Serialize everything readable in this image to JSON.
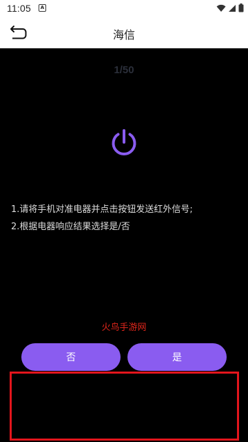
{
  "status_bar": {
    "time": "11:05",
    "notification_glyph": "A",
    "icons": [
      "wifi-icon",
      "signal-icon",
      "battery-icon"
    ]
  },
  "app_bar": {
    "back_icon": "back-arrow-icon",
    "title": "海信"
  },
  "main": {
    "counter": "1/50",
    "power_icon": "power-icon",
    "instructions": [
      "1.请将手机对准电器并点击按钮发送红外信号;",
      "2.根据电器响应结果选择是/否"
    ],
    "watermark": "火鸟手游网"
  },
  "answers": {
    "no_label": "否",
    "yes_label": "是"
  },
  "colors": {
    "accent": "#8a5cf0",
    "background": "#000000",
    "highlight_border": "#e3151c",
    "watermark": "#e0261b"
  }
}
